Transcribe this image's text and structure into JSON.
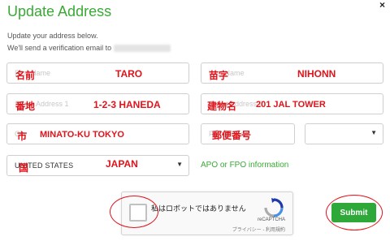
{
  "dialog": {
    "title": "Update Address",
    "close_symbol": "×",
    "intro_line1": "Update your address below.",
    "intro_line2": "We'll send a verification email to"
  },
  "form": {
    "first_name": {
      "placeholder": "First Name",
      "annotation_label": "名前",
      "annotation_value": "TARO"
    },
    "last_name": {
      "placeholder": "Last Name",
      "annotation_label": "苗字",
      "annotation_value": "NIHONN"
    },
    "address1": {
      "placeholder": "Street Address 1",
      "annotation_label": "番地",
      "annotation_value": "1-2-3 HANEDA"
    },
    "address2": {
      "placeholder": "Street Address 2",
      "annotation_label": "建物名",
      "annotation_value": "201 JAL TOWER"
    },
    "city": {
      "placeholder": "City",
      "annotation_label": "市",
      "annotation_value": "MINATO-KU TOKYO"
    },
    "postal_code": {
      "placeholder": "Postal Code",
      "annotation_label": "郵便番号"
    },
    "state_select": {
      "value": "",
      "caret": "▼"
    },
    "country_select": {
      "value": "UNITED STATES",
      "caret": "▼",
      "annotation_label": "国",
      "annotation_value": "JAPAN"
    },
    "apo_link": "APO or FPO information"
  },
  "recaptcha": {
    "checkbox_label": "私はロボットではありません",
    "brand": "reCAPTCHA",
    "links": "プライバシー - 利用規約"
  },
  "submit_label": "Submit",
  "colors": {
    "accent": "#3aa935",
    "annotation": "#e0131a",
    "submit_bg": "#2fa83a"
  }
}
